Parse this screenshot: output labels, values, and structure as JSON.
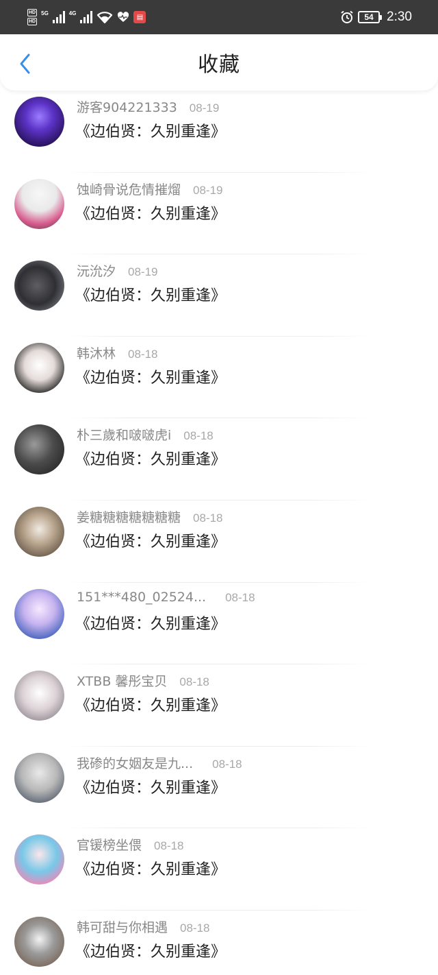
{
  "status_bar": {
    "hd1": "HD",
    "hd2": "HD",
    "net1": "5G",
    "net2": "4G",
    "battery": "54",
    "time": "2:30",
    "icons": [
      "signal-icon",
      "wifi-icon",
      "heart-icon",
      "app-notification-icon",
      "alarm-icon",
      "battery-icon"
    ]
  },
  "header": {
    "title": "收藏",
    "back_icon": "chevron-left-icon",
    "accent": "#3a8ee6"
  },
  "favorites": [
    {
      "user": "游客904221333",
      "date": "08-19",
      "book": "《边伯贤：久别重逢》"
    },
    {
      "user": "蚀崎骨说危情摧熘",
      "date": "08-19",
      "book": "《边伯贤：久别重逢》"
    },
    {
      "user": "沅沇汐",
      "date": "08-19",
      "book": "《边伯贤：久别重逢》"
    },
    {
      "user": "韩沐林",
      "date": "08-18",
      "book": "《边伯贤：久别重逢》"
    },
    {
      "user": "朴三歲和啵啵虎i",
      "date": "08-18",
      "book": "《边伯贤：久别重逢》"
    },
    {
      "user": "姜糖糖糖糖糖糖糖",
      "date": "08-18",
      "book": "《边伯贤：久别重逢》"
    },
    {
      "user": "151***480_02524...",
      "date": "08-18",
      "book": "《边伯贤：久别重逢》"
    },
    {
      "user": "XTBB 馨彤宝贝",
      "date": "08-18",
      "book": "《边伯贤：久别重逢》"
    },
    {
      "user": "我碜的女姻友是九...",
      "date": "08-18",
      "book": "《边伯贤：久别重逢》"
    },
    {
      "user": "官锾榜坐偎",
      "date": "08-18",
      "book": "《边伯贤：久别重逢》"
    },
    {
      "user": "韩可甜与你相遇",
      "date": "08-18",
      "book": "《边伯贤：久别重逢》"
    }
  ]
}
